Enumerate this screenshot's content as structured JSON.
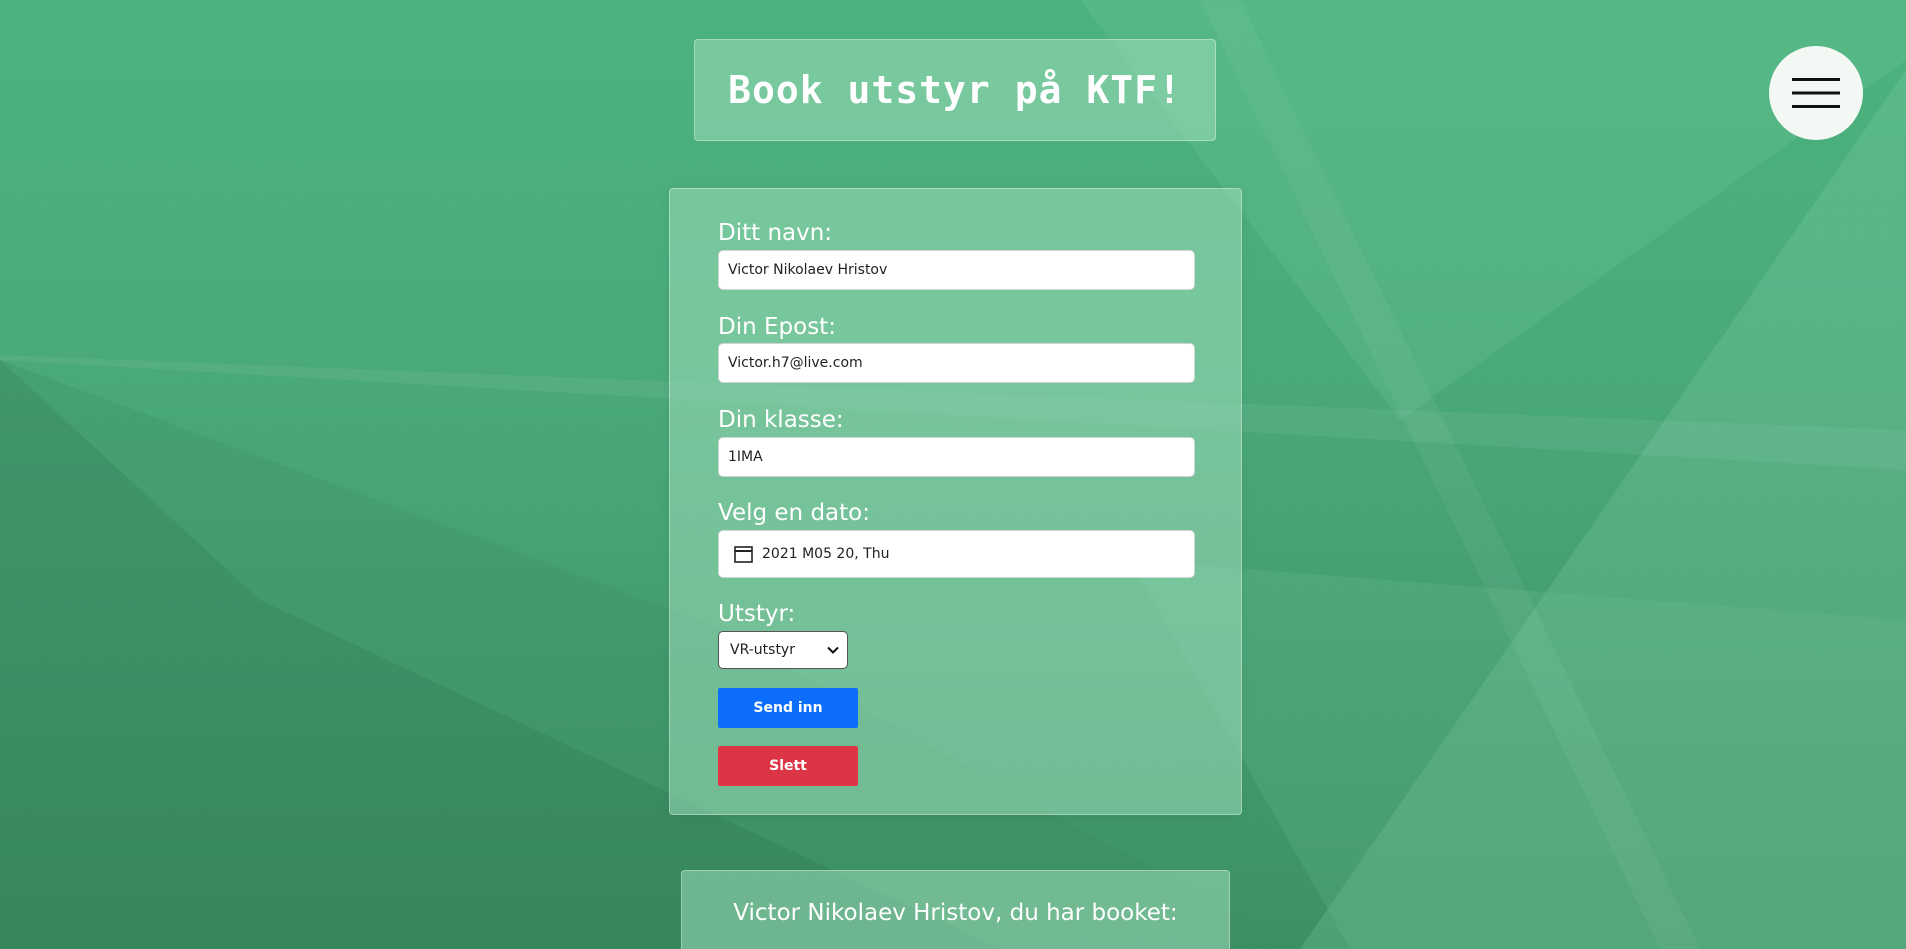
{
  "header": {
    "title": "Book utstyr på KTF!"
  },
  "menu": {
    "icon": "hamburger-menu-icon"
  },
  "form": {
    "name_label": "Ditt navn:",
    "name_value": "Victor Nikolaev Hristov",
    "email_label": "Din Epost:",
    "email_value": "Victor.h7@live.com",
    "class_label": "Din klasse:",
    "class_value": "1IMA",
    "date_label": "Velg en dato:",
    "date_value": "2021 M05 20, Thu",
    "date_icon": "calendar-icon",
    "equipment_label": "Utstyr:",
    "equipment_selected": "VR-utstyr",
    "submit_label": "Send inn",
    "delete_label": "Slett"
  },
  "result": {
    "heading": "Victor Nikolaev Hristov, du har booket:"
  },
  "colors": {
    "background": "#4cb37e",
    "panel": "#9ddcb9",
    "submit": "#0d6efd",
    "delete": "#dc3545"
  }
}
